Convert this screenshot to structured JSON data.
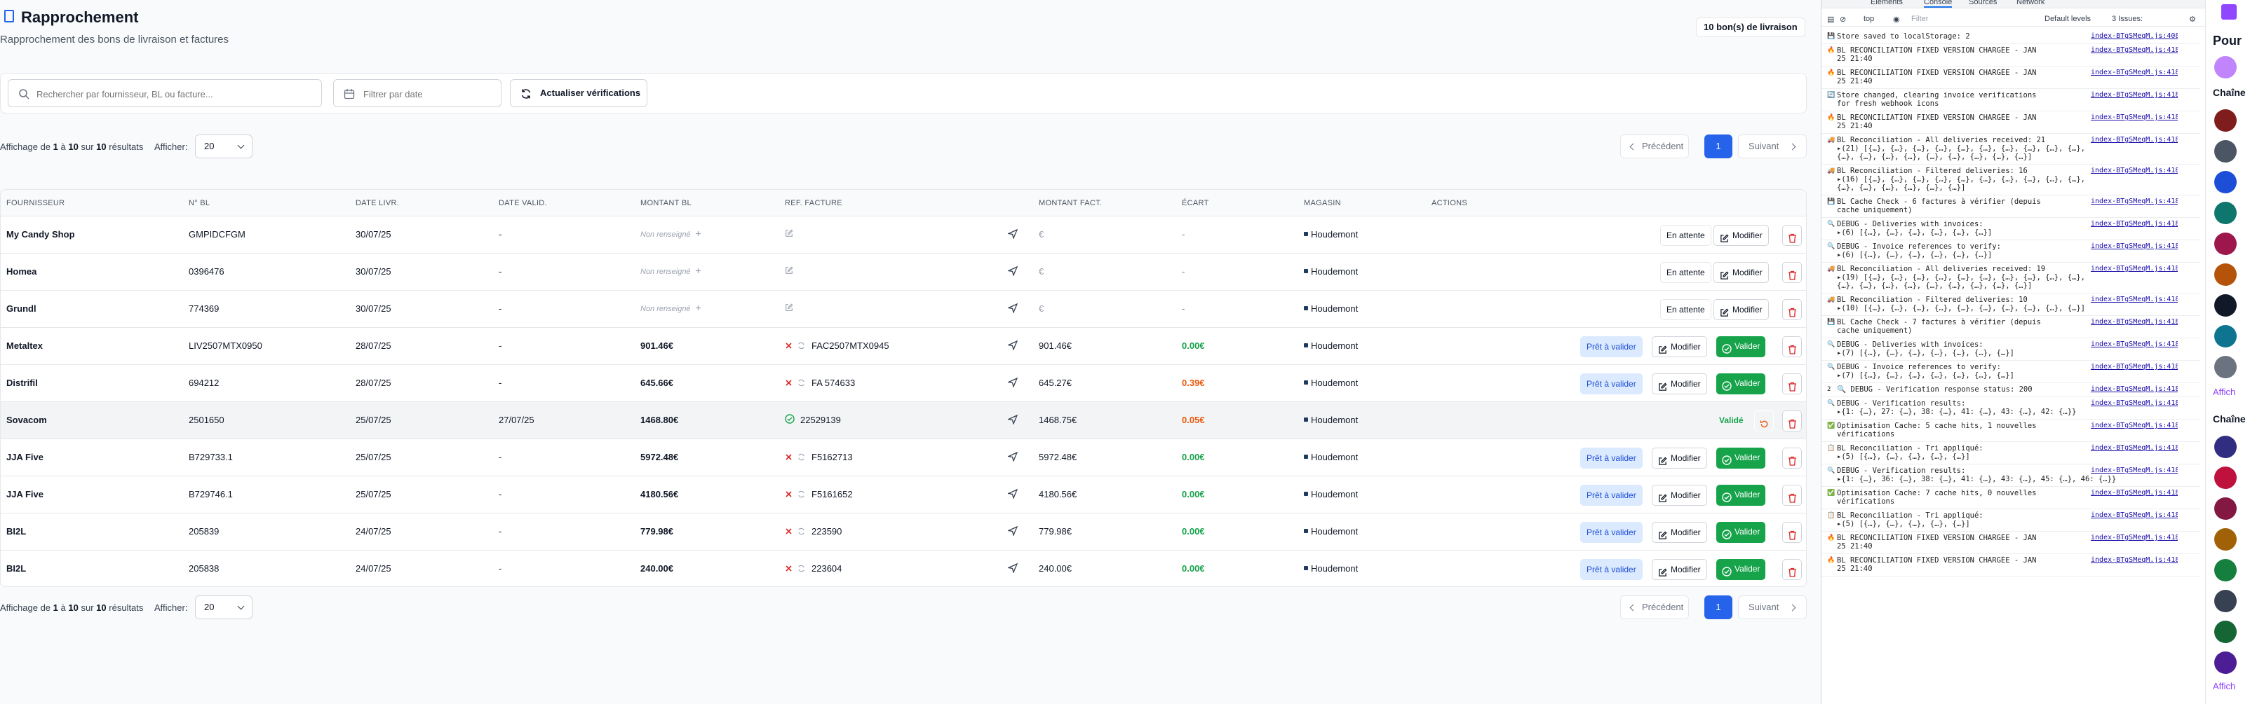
{
  "page": {
    "title": "Rapprochement",
    "subtitle": "Rapprochement des bons de livraison et factures",
    "count_badge": "10 bon(s) de livraison"
  },
  "filters": {
    "search_placeholder": "Rechercher par fournisseur, BL ou facture...",
    "date_placeholder": "Filtrer par date",
    "refresh_label": "Actualiser vérifications"
  },
  "pagination": {
    "info_prefix": "Affichage de",
    "from": "1",
    "to_word": "à",
    "to": "10",
    "of_word": "sur",
    "total": "10",
    "suffix": "résultats",
    "per_page_label": "Afficher:",
    "per_page": "20",
    "prev": "Précédent",
    "page": "1",
    "next": "Suivant"
  },
  "table": {
    "headers": [
      "FOURNISSEUR",
      "N° BL",
      "DATE LIVR.",
      "DATE VALID.",
      "MONTANT BL",
      "REF. FACTURE",
      "MONTANT FACT.",
      "ÉCART",
      "MAGASIN",
      "ACTIONS"
    ],
    "rows": [
      {
        "supplier": "My Candy Shop",
        "bl": "GMPIDCFGM",
        "date_livr": "30/07/25",
        "date_valid": "-",
        "montant_bl": "Non renseigné",
        "ref": "",
        "montant_fact": "€",
        "ecart": "-",
        "ecart_color": "dash",
        "magasin": "Houdemont",
        "status": "En attente",
        "mode": "wait"
      },
      {
        "supplier": "Homea",
        "bl": "0396476",
        "date_livr": "30/07/25",
        "date_valid": "-",
        "montant_bl": "Non renseigné",
        "ref": "",
        "montant_fact": "€",
        "ecart": "-",
        "ecart_color": "dash",
        "magasin": "Houdemont",
        "status": "En attente",
        "mode": "wait"
      },
      {
        "supplier": "Grundl",
        "bl": "774369",
        "date_livr": "30/07/25",
        "date_valid": "-",
        "montant_bl": "Non renseigné",
        "ref": "",
        "montant_fact": "€",
        "ecart": "-",
        "ecart_color": "dash",
        "magasin": "Houdemont",
        "status": "En attente",
        "mode": "wait"
      },
      {
        "supplier": "Metaltex",
        "bl": "LIV2507MTX0950",
        "date_livr": "28/07/25",
        "date_valid": "-",
        "montant_bl": "901.46€",
        "ref": "FAC2507MTX0945",
        "montant_fact": "901.46€",
        "ecart": "0.00€",
        "ecart_color": "g",
        "magasin": "Houdemont",
        "status": "Prêt à valider",
        "mode": "ready"
      },
      {
        "supplier": "Distrifil",
        "bl": "694212",
        "date_livr": "28/07/25",
        "date_valid": "-",
        "montant_bl": "645.66€",
        "ref": "FA 574633",
        "montant_fact": "645.27€",
        "ecart": "0.39€",
        "ecart_color": "o",
        "magasin": "Houdemont",
        "status": "Prêt à valider",
        "mode": "ready"
      },
      {
        "supplier": "Sovacom",
        "bl": "2501650",
        "date_livr": "25/07/25",
        "date_valid": "27/07/25",
        "montant_bl": "1468.80€",
        "ref": "22529139",
        "montant_fact": "1468.75€",
        "ecart": "0.05€",
        "ecart_color": "o",
        "magasin": "Houdemont",
        "status": "Validé",
        "mode": "done"
      },
      {
        "supplier": "JJA Five",
        "bl": "B729733.1",
        "date_livr": "25/07/25",
        "date_valid": "-",
        "montant_bl": "5972.48€",
        "ref": "F5162713",
        "montant_fact": "5972.48€",
        "ecart": "0.00€",
        "ecart_color": "g",
        "magasin": "Houdemont",
        "status": "Prêt à valider",
        "mode": "ready"
      },
      {
        "supplier": "JJA Five",
        "bl": "B729746.1",
        "date_livr": "25/07/25",
        "date_valid": "-",
        "montant_bl": "4180.56€",
        "ref": "F5161652",
        "montant_fact": "4180.56€",
        "ecart": "0.00€",
        "ecart_color": "g",
        "magasin": "Houdemont",
        "status": "Prêt à valider",
        "mode": "ready"
      },
      {
        "supplier": "BI2L",
        "bl": "205839",
        "date_livr": "24/07/25",
        "date_valid": "-",
        "montant_bl": "779.98€",
        "ref": "223590",
        "montant_fact": "779.98€",
        "ecart": "0.00€",
        "ecart_color": "g",
        "magasin": "Houdemont",
        "status": "Prêt à valider",
        "mode": "ready"
      },
      {
        "supplier": "BI2L",
        "bl": "205838",
        "date_livr": "24/07/25",
        "date_valid": "-",
        "montant_bl": "240.00€",
        "ref": "223604",
        "montant_fact": "240.00€",
        "ecart": "0.00€",
        "ecart_color": "g",
        "magasin": "Houdemont",
        "status": "Prêt à valider",
        "mode": "ready"
      }
    ],
    "modify_label": "Modifier",
    "validate_label": "Valider"
  },
  "devtools": {
    "tabs": [
      "Elements",
      "Console",
      "Sources",
      "Network"
    ],
    "context": "top",
    "filter_placeholder": "Filter",
    "levels": "Default levels",
    "issues": "3 Issues:",
    "logs": [
      {
        "icon": "💾",
        "text": "Store saved to localStorage: 2",
        "src": "index-BTgSMeqM.js:408"
      },
      {
        "icon": "🔥",
        "text": "BL RECONCILIATION FIXED VERSION CHARGÉE - JAN\n25 21:40",
        "src": "index-BTgSMeqM.js:418"
      },
      {
        "icon": "🔥",
        "text": "BL RECONCILIATION FIXED VERSION CHARGÉE - JAN\n25 21:40",
        "src": "index-BTgSMeqM.js:418"
      },
      {
        "icon": "🔄",
        "text": "Store changed, clearing invoice verifications\nfor fresh webhook icons",
        "src": "index-BTgSMeqM.js:418"
      },
      {
        "icon": "🔥",
        "text": "BL RECONCILIATION FIXED VERSION CHARGÉE - JAN\n25 21:40",
        "src": "index-BTgSMeqM.js:418"
      },
      {
        "icon": "🚚",
        "text": "BL Reconciliation - All deliveries received: 21\n▸(21) [{…}, {…}, {…}, {…}, {…}, {…}, {…}, {…}, {…}, {…},\n{…}, {…}, {…}, {…}, {…}, {…}, {…}, {…}, {…}]",
        "src": "index-BTgSMeqM.js:418"
      },
      {
        "icon": "🚚",
        "text": "BL Reconciliation - Filtered deliveries: 16\n▸(16) [{…}, {…}, {…}, {…}, {…}, {…}, {…}, {…}, {…}, {…},\n{…}, {…}, {…}, {…}, {…}, {…}]",
        "src": "index-BTgSMeqM.js:418"
      },
      {
        "icon": "💾",
        "text": "BL Cache Check - 6 factures à vérifier (depuis\ncache uniquement)",
        "src": "index-BTgSMeqM.js:418"
      },
      {
        "icon": "🔍",
        "text": "DEBUG - Deliveries with invoices:\n▸(6) [{…}, {…}, {…}, {…}, {…}, {…}]",
        "src": "index-BTgSMeqM.js:418"
      },
      {
        "icon": "🔍",
        "text": "DEBUG - Invoice references to verify:\n▸(6) [{…}, {…}, {…}, {…}, {…}, {…}]",
        "src": "index-BTgSMeqM.js:418"
      },
      {
        "icon": "🚚",
        "text": "BL Reconciliation - All deliveries received: 19\n▸(19) [{…}, {…}, {…}, {…}, {…}, {…}, {…}, {…}, {…}, {…},\n{…}, {…}, {…}, {…}, {…}, {…}, {…}, {…}, {…}]",
        "src": "index-BTgSMeqM.js:418"
      },
      {
        "icon": "🚚",
        "text": "BL Reconciliation - Filtered deliveries: 10\n▸(10) [{…}, {…}, {…}, {…}, {…}, {…}, {…}, {…}, {…}, {…}]",
        "src": "index-BTgSMeqM.js:418"
      },
      {
        "icon": "💾",
        "text": "BL Cache Check - 7 factures à vérifier (depuis\ncache uniquement)",
        "src": "index-BTgSMeqM.js:418"
      },
      {
        "icon": "🔍",
        "text": "DEBUG - Deliveries with invoices:\n▸(7) [{…}, {…}, {…}, {…}, {…}, {…}, {…}]",
        "src": "index-BTgSMeqM.js:418"
      },
      {
        "icon": "🔍",
        "text": "DEBUG - Invoice references to verify:\n▸(7) [{…}, {…}, {…}, {…}, {…}, {…}, {…}]",
        "src": "index-BTgSMeqM.js:418"
      },
      {
        "icon": "2",
        "text": "🔍 DEBUG - Verification response status: 200",
        "src": "index-BTgSMeqM.js:418"
      },
      {
        "icon": "🔍",
        "text": "DEBUG - Verification results:\n▸{1: {…}, 27: {…}, 38: {…}, 41: {…}, 43: {…}, 42: {…}}",
        "src": "index-BTgSMeqM.js:418"
      },
      {
        "icon": "✅",
        "text": "Optimisation Cache: 5 cache hits, 1 nouvelles\nvérifications",
        "src": "index-BTgSMeqM.js:418"
      },
      {
        "icon": "📋",
        "text": "BL Reconciliation - Tri appliqué:\n▸(5) [{…}, {…}, {…}, {…}, {…}]",
        "src": "index-BTgSMeqM.js:418"
      },
      {
        "icon": "🔍",
        "text": "DEBUG - Verification results:\n▸{1: {…}, 36: {…}, 38: {…}, 41: {…}, 43: {…}, 45: {…}, 46: {…}}",
        "src": "index-BTgSMeqM.js:418"
      },
      {
        "icon": "✅",
        "text": "Optimisation Cache: 7 cache hits, 0 nouvelles\nvérifications",
        "src": "index-BTgSMeqM.js:418"
      },
      {
        "icon": "📋",
        "text": "BL Reconciliation - Tri appliqué:\n▸(5) [{…}, {…}, {…}, {…}, {…}]",
        "src": "index-BTgSMeqM.js:418"
      },
      {
        "icon": "🔥",
        "text": "BL RECONCILIATION FIXED VERSION CHARGÉE - JAN\n25 21:40",
        "src": "index-BTgSMeqM.js:418"
      },
      {
        "icon": "🔥",
        "text": "BL RECONCILIATION FIXED VERSION CHARGÉE - JAN\n25 21:40",
        "src": "index-BTgSMeqM.js:418"
      }
    ]
  },
  "twitch": {
    "for_you": "Pour",
    "channels": "Chaîne",
    "show_more": "Affich",
    "accent": "#9146ff"
  }
}
